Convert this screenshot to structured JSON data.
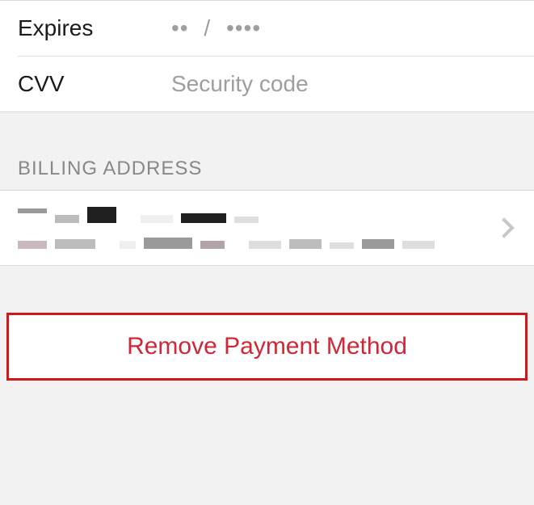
{
  "form": {
    "expires": {
      "label": "Expires",
      "month_placeholder": "••",
      "separator": "/",
      "year_placeholder": "••••"
    },
    "cvv": {
      "label": "CVV",
      "placeholder": "Security code"
    }
  },
  "billing_address": {
    "header": "BILLING ADDRESS"
  },
  "actions": {
    "remove_label": "Remove Payment Method"
  }
}
